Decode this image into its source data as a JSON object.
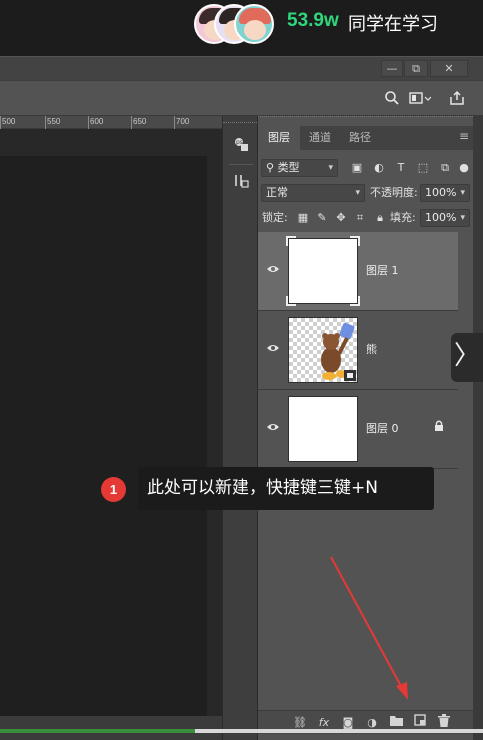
{
  "overlay": {
    "learner_count": "53.9w",
    "learner_text": "同学在学习"
  },
  "window": {
    "minimize": "—",
    "restore": "⧉",
    "close": "✕"
  },
  "options_bar": {
    "icons": [
      "search-icon",
      "screen-mode-icon",
      "share-icon"
    ]
  },
  "ruler": {
    "ticks": [
      "500",
      "550",
      "600",
      "650",
      "700"
    ]
  },
  "layers_panel": {
    "tabs": [
      "图层",
      "通道",
      "路径"
    ],
    "active_tab": "图层",
    "filter_type": "类型",
    "blend_mode": "正常",
    "opacity_label": "不透明度:",
    "opacity_value": "100%",
    "lock_label": "锁定:",
    "fill_label": "填充:",
    "fill_value": "100%",
    "layers": [
      {
        "name": "图层 1",
        "selected": true,
        "visible": true,
        "locked": false,
        "thumb": "white"
      },
      {
        "name": "熊",
        "selected": false,
        "visible": true,
        "locked": false,
        "thumb": "transparent-bear"
      },
      {
        "name": "图层 0",
        "selected": false,
        "visible": true,
        "locked": true,
        "thumb": "white"
      }
    ],
    "bottom_icons": [
      "link-icon",
      "fx-icon",
      "mask-icon",
      "adjustment-icon",
      "folder-icon",
      "new-layer-icon",
      "trash-icon"
    ],
    "fx_text": "fx"
  },
  "tooltip": {
    "step_number": "1",
    "text": "此处可以新建，快捷键三键+N"
  },
  "colors": {
    "accent_green": "#30d67b",
    "badge_red": "#e53935",
    "arrow_red": "#e53935"
  }
}
